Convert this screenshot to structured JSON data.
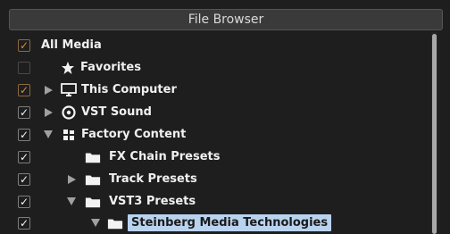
{
  "panel": {
    "title": "File Browser"
  },
  "tree": {
    "items": [
      {
        "label": "All Media",
        "checked": "partial"
      },
      {
        "label": "Favorites",
        "checked": "none"
      },
      {
        "label": "This Computer",
        "checked": "partial"
      },
      {
        "label": "VST Sound",
        "checked": "checked"
      },
      {
        "label": "Factory Content",
        "checked": "checked"
      },
      {
        "label": "FX Chain Presets",
        "checked": "checked"
      },
      {
        "label": "Track Presets",
        "checked": "checked"
      },
      {
        "label": "VST3 Presets",
        "checked": "checked"
      },
      {
        "label": "Steinberg Media Technologies",
        "checked": "checked",
        "selected": true
      }
    ]
  },
  "colors": {
    "background": "#1e1e1e",
    "selection": "#b9d3ef",
    "partial_check": "#d98c2a"
  }
}
